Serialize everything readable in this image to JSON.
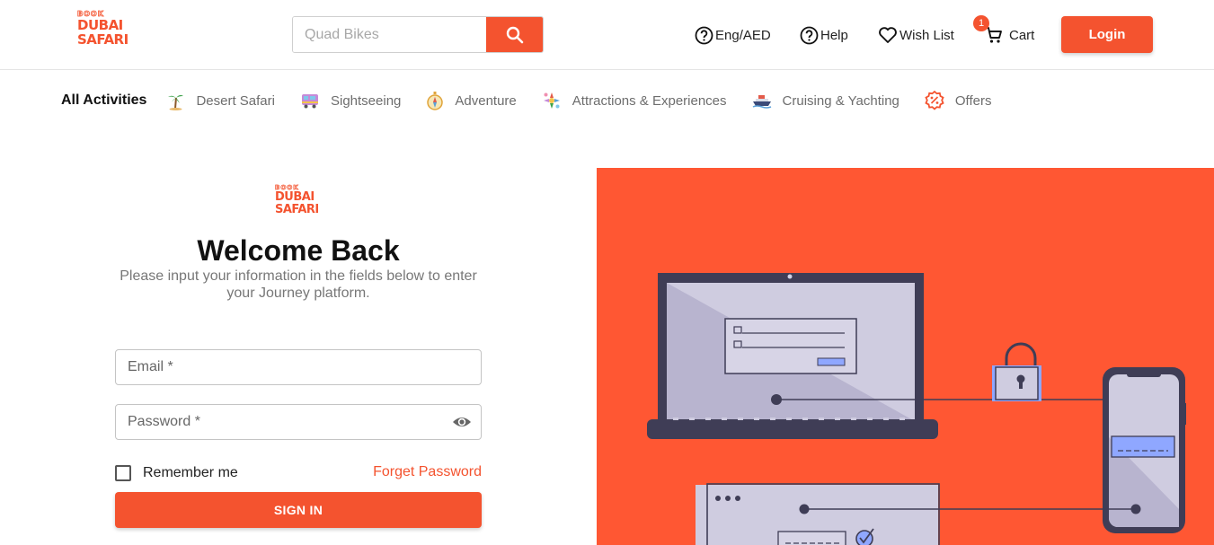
{
  "brand": {
    "line1": "BOOK",
    "line2": "DUBAI",
    "line3": "SAFARI"
  },
  "colors": {
    "accent": "#f4532f",
    "hero_bg": "#ff5733"
  },
  "header": {
    "search_placeholder": "Quad Bikes",
    "lang_label": "Eng/AED",
    "help_label": "Help",
    "wishlist_label": "Wish List",
    "cart_label": "Cart",
    "cart_count": "1",
    "login_label": "Login"
  },
  "categories": {
    "all_label": "All Activities",
    "items": [
      {
        "label": "Desert Safari",
        "icon": "palm-tree-icon"
      },
      {
        "label": "Sightseeing",
        "icon": "bus-icon"
      },
      {
        "label": "Adventure",
        "icon": "compass-icon"
      },
      {
        "label": "Attractions & Experiences",
        "icon": "attractions-icon"
      },
      {
        "label": "Cruising & Yachting",
        "icon": "ship-icon"
      },
      {
        "label": "Offers",
        "icon": "discount-icon"
      }
    ]
  },
  "login_form": {
    "title": "Welcome Back",
    "subtitle": "Please input your information in the fields below to enter your Journey platform.",
    "email_placeholder": "Email *",
    "password_placeholder": "Password *",
    "remember_label": "Remember me",
    "forgot_label": "Forget Password",
    "signin_label": "SIGN IN"
  }
}
